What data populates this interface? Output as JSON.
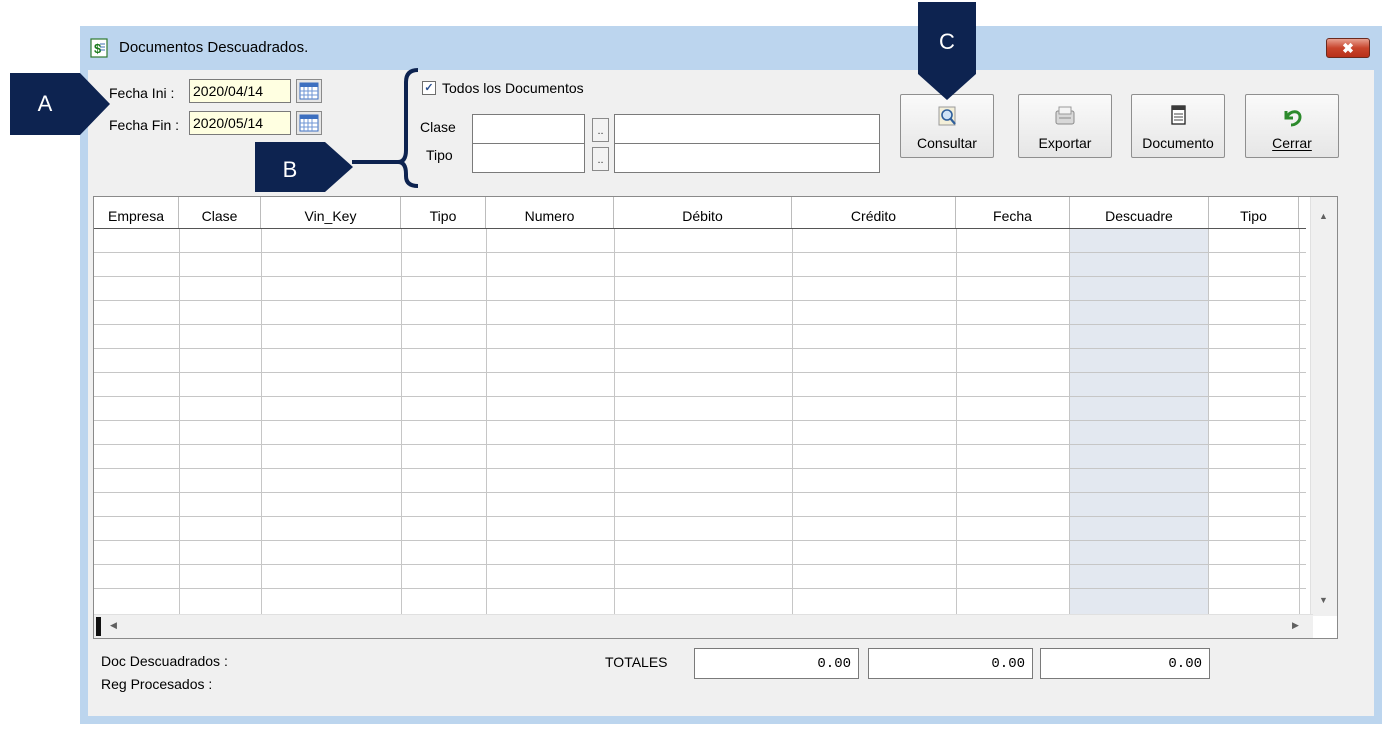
{
  "window": {
    "title": "Documentos Descuadrados.",
    "close_symbol": "✖"
  },
  "dates": {
    "fecha_ini_label": "Fecha Ini :",
    "fecha_ini_value": "2020/04/14",
    "fecha_fin_label": "Fecha Fin :",
    "fecha_fin_value": "2020/05/14"
  },
  "filters": {
    "todos_label": "Todos los Documentos",
    "todos_checked": true,
    "check_mark": "✓",
    "clase_label": "Clase",
    "tipo_label": "Tipo",
    "dots": ".."
  },
  "toolbar": {
    "consultar": "Consultar",
    "exportar": "Exportar",
    "documento": "Documento",
    "cerrar": "Cerrar"
  },
  "grid": {
    "columns": [
      "Empresa",
      "Clase",
      "Vin_Key",
      "Tipo",
      "Numero",
      "Débito",
      "Crédito",
      "Fecha",
      "Descuadre",
      "Tipo"
    ],
    "scroll_up": "▲",
    "scroll_down": "▼",
    "scroll_left": "◀",
    "scroll_right": "▶"
  },
  "footer": {
    "doc_descuadrados_label": "Doc Descuadrados :",
    "reg_procesados_label": "Reg Procesados :",
    "totales_label": "TOTALES",
    "total_debito": "0.00",
    "total_credito": "0.00",
    "total_descuadre": "0.00"
  },
  "annotations": {
    "a": "A",
    "b": "B",
    "c": "C",
    "color": "#0d2350"
  }
}
